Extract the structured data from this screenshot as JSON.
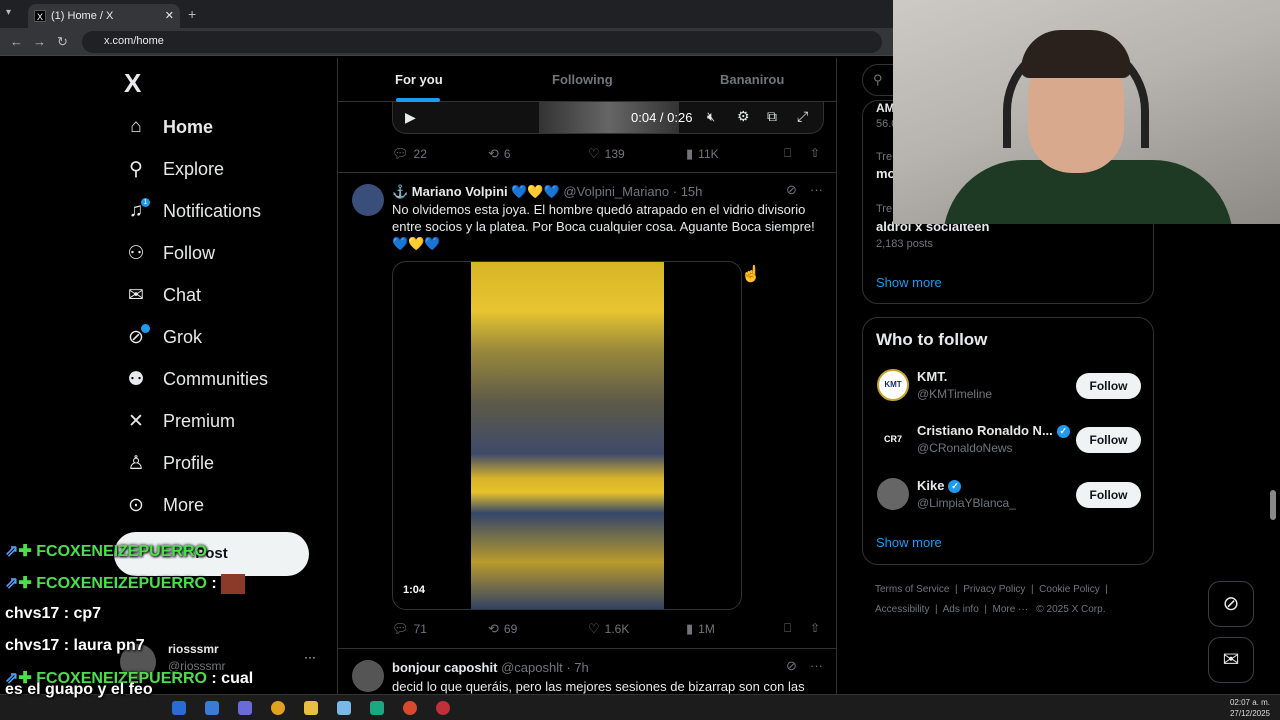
{
  "browser": {
    "tab_title": "(1) Home / X",
    "tab_favicon": "X",
    "url": "x.com/home",
    "new_tab": "+",
    "close": "✕"
  },
  "nav": {
    "logo": "X",
    "items": [
      {
        "label": "Home",
        "icon": "home-icon"
      },
      {
        "label": "Explore",
        "icon": "search-icon"
      },
      {
        "label": "Notifications",
        "icon": "bell-icon",
        "badge": "1"
      },
      {
        "label": "Follow",
        "icon": "add-person-icon"
      },
      {
        "label": "Chat",
        "icon": "mail-icon"
      },
      {
        "label": "Grok",
        "icon": "grok-icon"
      },
      {
        "label": "Communities",
        "icon": "people-icon"
      },
      {
        "label": "Premium",
        "icon": "x-icon"
      },
      {
        "label": "Profile",
        "icon": "person-icon"
      },
      {
        "label": "More",
        "icon": "more-icon"
      }
    ],
    "post_label": "Post"
  },
  "account": {
    "name": "riosssmr",
    "handle": "@riosssmr",
    "more": "···"
  },
  "chat_overlay": [
    {
      "user": "FCOXENEIZEPUERRO",
      "msg": ""
    },
    {
      "user": "FCOXENEIZEPUERRO",
      "msg": ":"
    },
    {
      "user": "chvs17",
      "msg": ": cp7"
    },
    {
      "user": "chvs17",
      "msg": ": laura pn7"
    },
    {
      "user": "FCOXENEIZEPUERRO",
      "msg": ": cual"
    },
    {
      "user": "",
      "msg": "es el guapo y el feo"
    }
  ],
  "feed": {
    "tabs": [
      "For you",
      "Following",
      "Bananirou"
    ],
    "video_time": "0:04 / 0:26",
    "prev_actions": {
      "replies": "22",
      "reposts": "6",
      "likes": "139",
      "views": "11K"
    },
    "tweet1": {
      "name": "⚓ Mariano Volpini 💙💛💙",
      "handle": "@Volpini_Mariano",
      "time": "· 15h",
      "text": "No olvidemos esta joya. El hombre quedó atrapado en el vidrio divisorio entre socios y la platea. Por Boca cualquier cosa. Aguante Boca siempre!💙💛💙",
      "duration": "1:04",
      "replies": "71",
      "reposts": "69",
      "likes": "1.6K",
      "views": "1M"
    },
    "tweet2": {
      "name": "bonjour caposhit",
      "handle": "@caposhlt",
      "time": "· 7h",
      "text": "decid lo que queráis, pero las mejores sesiones de bizarrap son con las"
    }
  },
  "right": {
    "search_placeholder": "Search",
    "trend_partial_1": "AM",
    "trend_partial_2": "56.0",
    "trend_partial_3": "Tre",
    "trend_partial_4": "mo",
    "trend_partial_5": "Tre",
    "trend_last_name": "aldroi x socialteen",
    "trend_last_posts": "2,183 posts",
    "show_more": "Show more",
    "who_to_follow": "Who to follow",
    "suggestions": [
      {
        "name": "KMT.",
        "handle": "@KMTimeline",
        "verified": false,
        "avatar_text": "KMT"
      },
      {
        "name": "Cristiano Ronaldo N...",
        "handle": "@CRonaldoNews",
        "verified": true,
        "avatar_text": "CR7"
      },
      {
        "name": "Kike",
        "handle": "@LimpiaYBlanca_",
        "verified": true,
        "avatar_text": ""
      }
    ],
    "follow_label": "Follow",
    "show_more_2": "Show more",
    "footer_line1": [
      "Terms of Service",
      "Privacy Policy",
      "Cookie Policy"
    ],
    "footer_line2": [
      "Accessibility",
      "Ads info",
      "More ···",
      "© 2025 X Corp."
    ]
  },
  "taskbar": {
    "time": "02:07 a. m.",
    "date": "27/12/2025"
  },
  "colors": {
    "accent": "#1d9bf0",
    "bg": "#000000",
    "text": "#e7e9ea",
    "muted": "#71767b",
    "chat_user": "#4be04b"
  }
}
